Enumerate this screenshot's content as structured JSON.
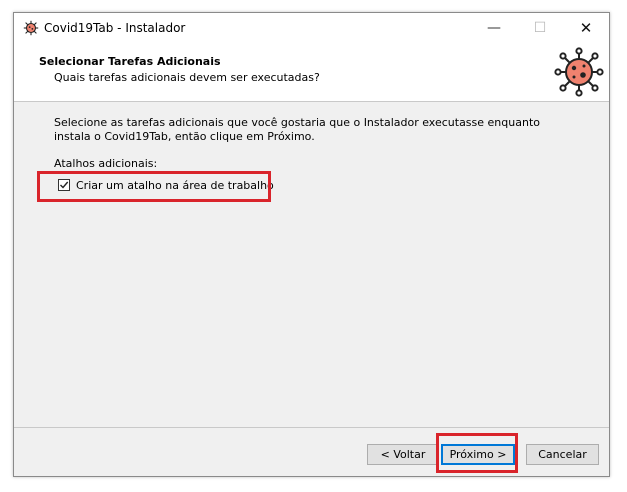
{
  "window": {
    "title": "Covid19Tab - Instalador",
    "controls": {
      "minimize": "—",
      "maximize": "☐",
      "close": "✕"
    }
  },
  "header": {
    "title": "Selecionar Tarefas Adicionais",
    "subtitle": "Quais tarefas adicionais devem ser executadas?",
    "icon": "virus-icon"
  },
  "main": {
    "intro": "Selecione as tarefas adicionais que você gostaria que o Instalador executasse enquanto instala o Covid19Tab, então clique em Próximo.",
    "group_label": "Atalhos adicionais:",
    "tasks": [
      {
        "label": "Criar um atalho na área de trabalho",
        "checked": true
      }
    ]
  },
  "footer": {
    "back_label": "< Voltar",
    "next_label": "Próximo >",
    "cancel_label": "Cancelar"
  },
  "colors": {
    "highlight": "#d9242b",
    "virus": "#f0826f",
    "focus_border": "#0078d7"
  }
}
